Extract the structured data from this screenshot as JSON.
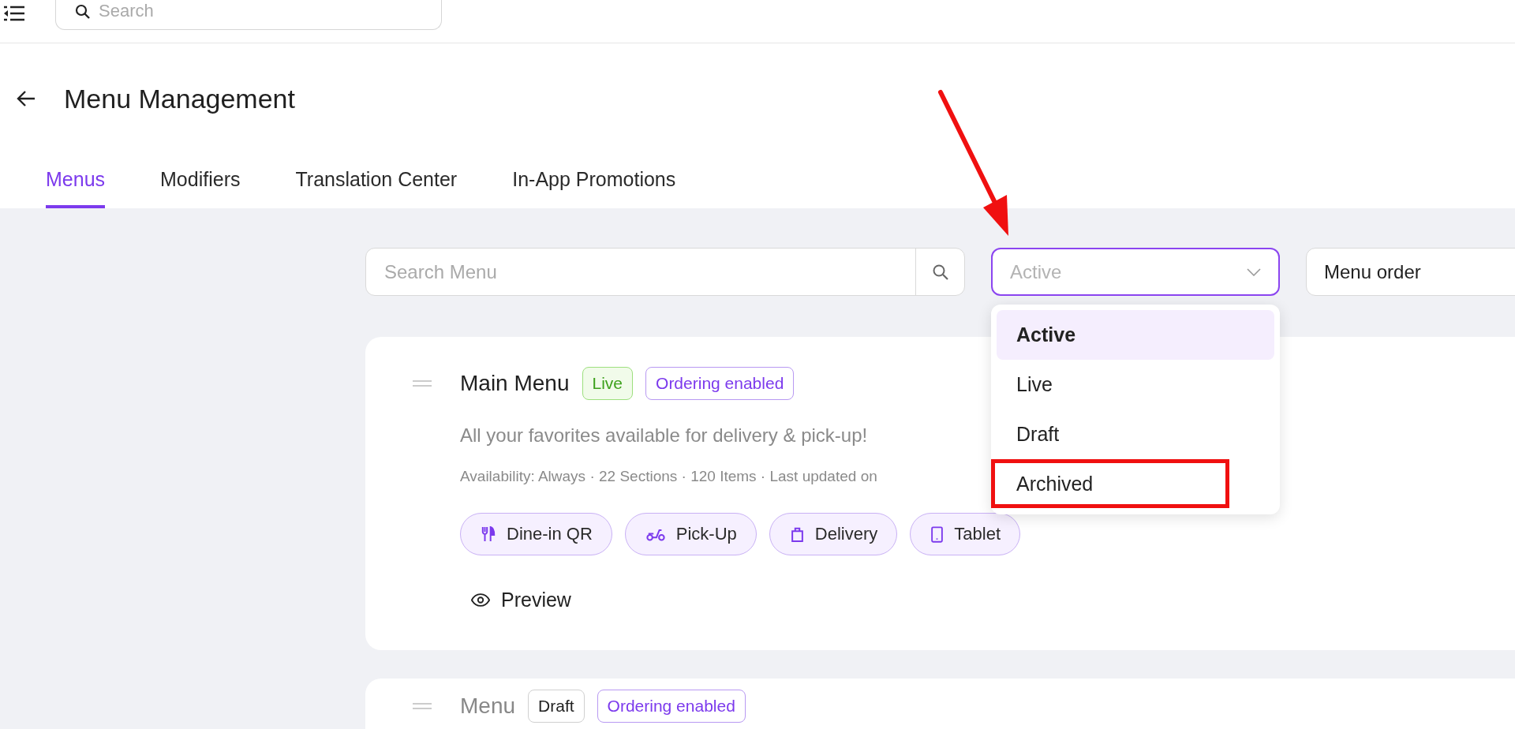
{
  "top_bar": {
    "search": {
      "placeholder": "Search"
    }
  },
  "page": {
    "title": "Menu Management"
  },
  "tabs": [
    {
      "label": "Menus",
      "selected": true
    },
    {
      "label": "Modifiers",
      "selected": false
    },
    {
      "label": "Translation Center",
      "selected": false
    },
    {
      "label": "In-App Promotions",
      "selected": false
    }
  ],
  "filters": {
    "search": {
      "placeholder": "Search Menu"
    },
    "status_select": {
      "placeholder": "Active",
      "expanded": true,
      "annotated": true,
      "options": [
        {
          "label": "Active",
          "selected": true,
          "annotated": false
        },
        {
          "label": "Live",
          "selected": false,
          "annotated": false
        },
        {
          "label": "Draft",
          "selected": false,
          "annotated": false
        },
        {
          "label": "Archived",
          "selected": false,
          "annotated": true
        }
      ]
    },
    "sort_select": {
      "value": "Menu order"
    }
  },
  "menus": [
    {
      "name": "Main Menu",
      "status": {
        "label": "Live",
        "kind": "live"
      },
      "ordering": "Ordering enabled",
      "description": "All your favorites available for delivery & pick-up!",
      "meta": "Availability: Always · 22 Sections · 120 Items · Last updated on",
      "channels": [
        {
          "label": "Dine-in QR",
          "kind": "dine_in"
        },
        {
          "label": "Pick-Up",
          "kind": "pickup"
        },
        {
          "label": "Delivery",
          "kind": "delivery"
        },
        {
          "label": "Tablet",
          "kind": "tablet"
        }
      ],
      "preview": "Preview"
    },
    {
      "name": "Menu",
      "status": {
        "label": "Draft",
        "kind": "draft"
      },
      "ordering": "Ordering enabled"
    }
  ]
}
